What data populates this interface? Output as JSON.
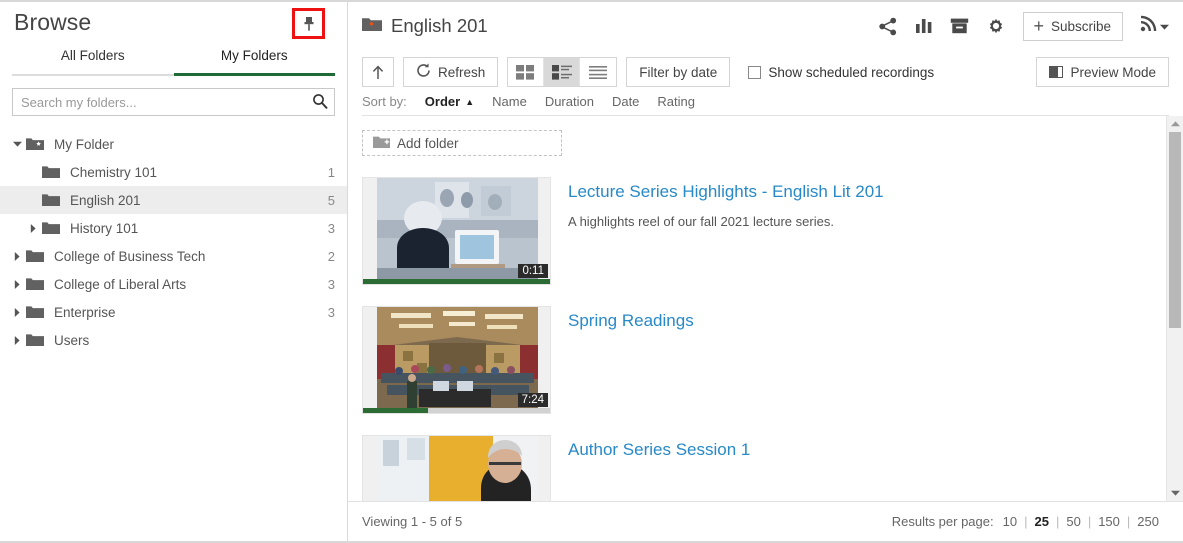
{
  "sidebar": {
    "title": "Browse",
    "pin_icon": "pin-icon",
    "tabs": [
      {
        "label": "All Folders",
        "active": false
      },
      {
        "label": "My Folders",
        "active": true
      }
    ],
    "search": {
      "placeholder": "Search my folders...",
      "value": "",
      "icon": "search-icon"
    },
    "tree": [
      {
        "label": "My Folder",
        "count": "",
        "depth": 0,
        "arrow": "down",
        "icon": "folder-star-icon",
        "selected": false
      },
      {
        "label": "Chemistry 101",
        "count": "1",
        "depth": 1,
        "arrow": "none",
        "icon": "folder-icon",
        "selected": false
      },
      {
        "label": "English 201",
        "count": "5",
        "depth": 1,
        "arrow": "none",
        "icon": "folder-icon",
        "selected": true
      },
      {
        "label": "History 101",
        "count": "3",
        "depth": 1,
        "arrow": "right",
        "icon": "folder-icon",
        "selected": false
      },
      {
        "label": "College of Business Tech",
        "count": "2",
        "depth": 0,
        "arrow": "right",
        "icon": "folder-icon",
        "selected": false
      },
      {
        "label": "College of Liberal Arts",
        "count": "3",
        "depth": 0,
        "arrow": "right",
        "icon": "folder-icon",
        "selected": false
      },
      {
        "label": "Enterprise",
        "count": "3",
        "depth": 0,
        "arrow": "right",
        "icon": "folder-icon",
        "selected": false
      },
      {
        "label": "Users",
        "count": "",
        "depth": 0,
        "arrow": "right",
        "icon": "folder-icon",
        "selected": false
      }
    ]
  },
  "header": {
    "folder_icon": "folder-dot-icon",
    "title": "English 201",
    "actions": [
      {
        "name": "share-icon",
        "label": "Share"
      },
      {
        "name": "stats-icon",
        "label": "Statistics"
      },
      {
        "name": "archive-icon",
        "label": "Archive"
      },
      {
        "name": "gear-icon",
        "label": "Settings"
      }
    ],
    "subscribe_label": "Subscribe",
    "subscribe_plus": "+",
    "rss_icon": "rss-icon",
    "rss_caret": "chevron-down-icon"
  },
  "toolbar": {
    "up_icon": "arrow-up-icon",
    "refresh_label": "Refresh",
    "refresh_icon": "refresh-icon",
    "views": [
      {
        "name": "grid-view-icon",
        "active": false
      },
      {
        "name": "detail-view-icon",
        "active": true
      },
      {
        "name": "list-view-icon",
        "active": false
      }
    ],
    "filter_label": "Filter by date",
    "checkbox_label": "Show scheduled recordings",
    "checkbox_checked": false,
    "preview_label": "Preview Mode",
    "preview_icon": "preview-mode-icon"
  },
  "sortbar": {
    "label": "Sort by:",
    "items": [
      {
        "label": "Order",
        "active": true,
        "caret": "▲"
      },
      {
        "label": "Name",
        "active": false,
        "caret": ""
      },
      {
        "label": "Duration",
        "active": false,
        "caret": ""
      },
      {
        "label": "Date",
        "active": false,
        "caret": ""
      },
      {
        "label": "Rating",
        "active": false,
        "caret": ""
      }
    ]
  },
  "main": {
    "add_folder_label": "Add folder",
    "add_folder_icon": "folder-plus-icon",
    "videos": [
      {
        "title": "Lecture Series Highlights - English Lit 201",
        "description": "A highlights reel of our fall 2021 lecture series.",
        "duration": "0:11",
        "progress": 100,
        "thumb": "lecture-podium-thumbnail"
      },
      {
        "title": "Spring Readings",
        "description": "",
        "duration": "7:24",
        "progress": 35,
        "thumb": "lecture-hall-thumbnail"
      },
      {
        "title": "Author Series Session 1",
        "description": "",
        "duration": "",
        "progress": 0,
        "thumb": "author-audience-thumbnail"
      }
    ]
  },
  "scrollbar": {
    "up_icon": "scroll-up-icon",
    "down_icon": "scroll-down-icon"
  },
  "footer": {
    "viewing": "Viewing 1 - 5 of 5",
    "results_label": "Results per page:",
    "options": [
      {
        "label": "10",
        "active": false
      },
      {
        "label": "25",
        "active": true
      },
      {
        "label": "50",
        "active": false
      },
      {
        "label": "150",
        "active": false
      },
      {
        "label": "250",
        "active": false
      }
    ],
    "separator": "|"
  },
  "colors": {
    "accent_green": "#1e6b35",
    "link_blue": "#2789c8",
    "highlight_red": "#ee1111",
    "progress_green": "#2c6b34"
  }
}
